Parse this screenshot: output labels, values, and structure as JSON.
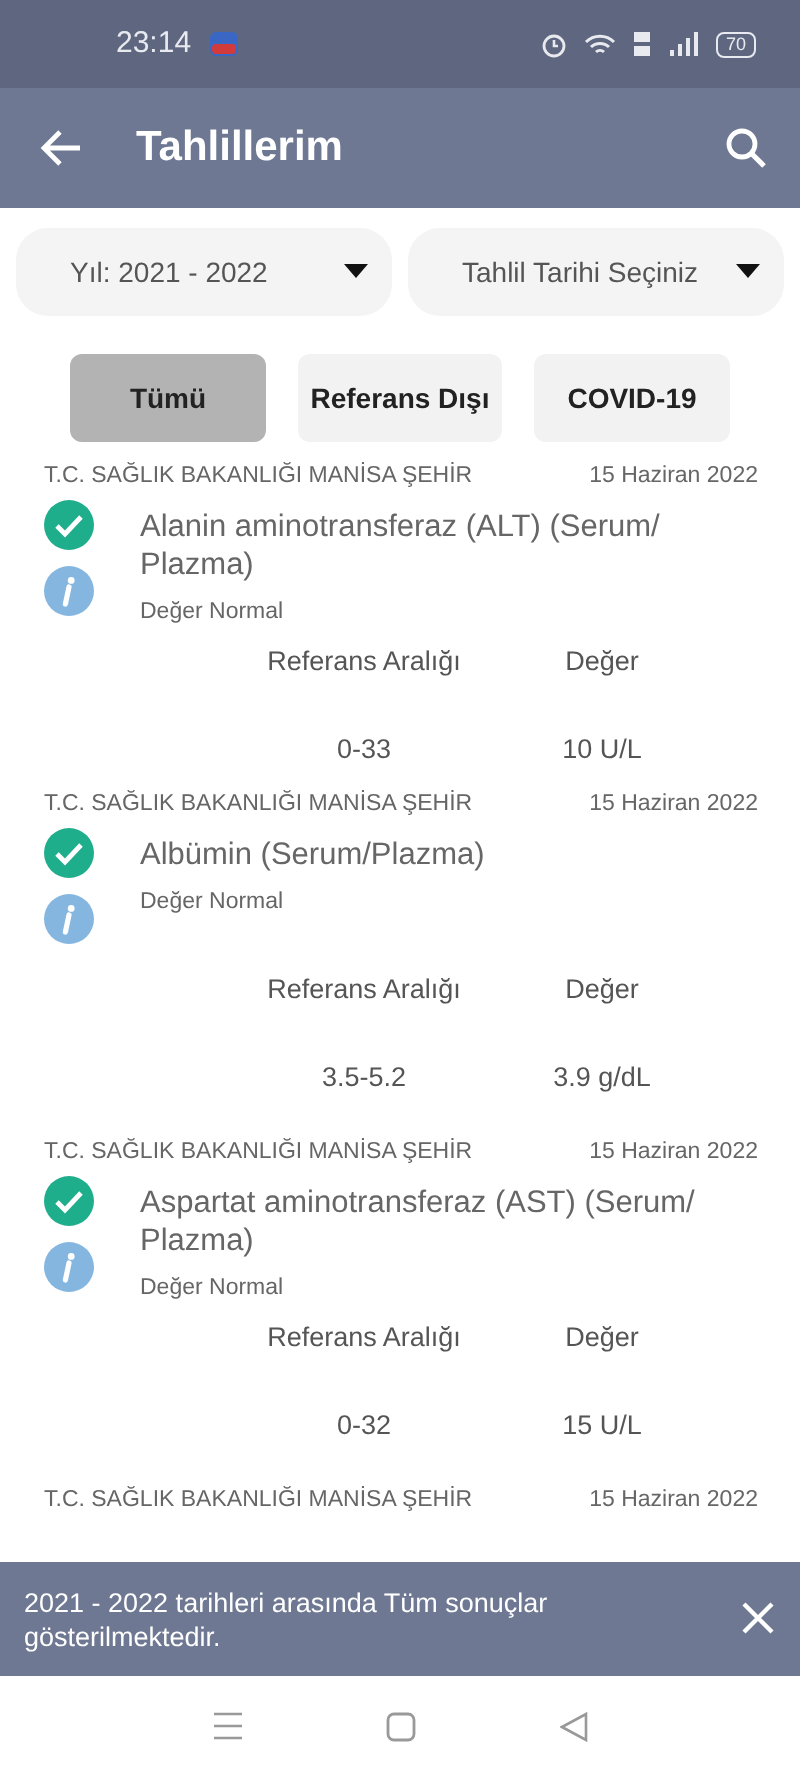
{
  "status_bar": {
    "time": "23:14",
    "battery": "70"
  },
  "app_bar": {
    "title": "Tahlillerim"
  },
  "dropdowns": [
    {
      "label": "Yıl: 2021 - 2022"
    },
    {
      "label": "Tahlil Tarihi Seçiniz"
    }
  ],
  "filters": [
    {
      "label": "Tümü",
      "selected": true
    },
    {
      "label": "Referans Dışı",
      "selected": false
    },
    {
      "label": "COVID-19",
      "selected": false
    }
  ],
  "results": [
    {
      "hospital": "T.C. SAĞLIK BAKANLIĞI MANİSA ŞEHİR",
      "date": "15 Haziran 2022",
      "test": "Alanin aminotransferaz (ALT) (Serum/ Plazma)",
      "status": "Değer Normal",
      "normal": true,
      "range_label": "Referans Aralığı",
      "value_label": "Değer",
      "range": "0-33",
      "value": "10 U/L"
    },
    {
      "hospital": "T.C. SAĞLIK BAKANLIĞI MANİSA ŞEHİR",
      "date": "15 Haziran 2022",
      "test": "Albümin (Serum/Plazma)",
      "status": "Değer Normal",
      "normal": true,
      "range_label": "Referans Aralığı",
      "value_label": "Değer",
      "range": "3.5-5.2",
      "value": "3.9 g/dL"
    },
    {
      "hospital": "T.C. SAĞLIK BAKANLIĞI MANİSA ŞEHİR",
      "date": "15 Haziran 2022",
      "test": "Aspartat aminotransferaz (AST) (Serum/ Plazma)",
      "status": "Değer Normal",
      "normal": true,
      "range_label": "Referans Aralığı",
      "value_label": "Değer",
      "range": "0-32",
      "value": "15 U/L"
    },
    {
      "hospital": "T.C. SAĞLIK BAKANLIĞI MANİSA ŞEHİR",
      "date": "15 Haziran 2022"
    }
  ],
  "snackbar": {
    "message": "2021 - 2022 tarihleri arasında Tüm sonuçlar gösterilmektedir."
  }
}
